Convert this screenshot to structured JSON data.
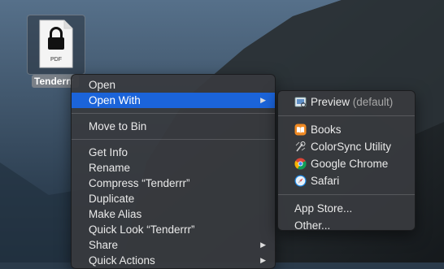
{
  "file": {
    "type_label": "PDF",
    "name": "Tenderrr"
  },
  "context_menu": {
    "items": [
      {
        "label": "Open"
      },
      {
        "label": "Open With"
      },
      {
        "label": "Move to Bin"
      },
      {
        "label": "Get Info"
      },
      {
        "label": "Rename"
      },
      {
        "label": "Compress “Tenderrr”"
      },
      {
        "label": "Duplicate"
      },
      {
        "label": "Make Alias"
      },
      {
        "label": "Quick Look “Tenderrr”"
      },
      {
        "label": "Share"
      },
      {
        "label": "Quick Actions"
      }
    ]
  },
  "open_with_submenu": {
    "default_app": {
      "label": "Preview",
      "suffix": "(default)",
      "icon": "preview-icon"
    },
    "apps": [
      {
        "label": "Books",
        "icon": "books-icon",
        "color": "#f08a24"
      },
      {
        "label": "ColorSync Utility",
        "icon": "colorsync-icon",
        "color": "#c8c8c8"
      },
      {
        "label": "Google Chrome",
        "icon": "chrome-icon",
        "color": "#4285f4"
      },
      {
        "label": "Safari",
        "icon": "safari-icon",
        "color": "#1e88e5"
      }
    ],
    "app_store": "App Store...",
    "other": "Other..."
  },
  "colors": {
    "menu_bg": "#38393c",
    "selection": "#1b64da",
    "text": "#eaeaea"
  }
}
